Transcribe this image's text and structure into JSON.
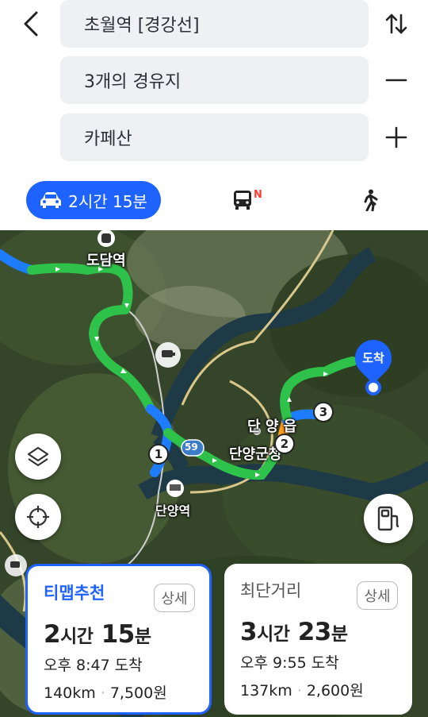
{
  "search": {
    "origin": "초월역 [경강선]",
    "waypoints": "3개의 경유지",
    "destination": "카페산"
  },
  "modes": {
    "car_time": "2시간 15분",
    "bus_badge": "N"
  },
  "map": {
    "labels": {
      "dodam": "도담역",
      "danyang_eup": "단 양 읍",
      "danyang_gun": "단양군청",
      "danyang_station": "단양역",
      "road_no": "59",
      "dest": "도착"
    },
    "waypoint_numbers": [
      "1",
      "2",
      "3"
    ],
    "route_color": "#2fc24a",
    "route_blue": "#1e7cff"
  },
  "routes": [
    {
      "name": "티맵추천",
      "detail": "상세",
      "hours": "2",
      "hours_unit": "시간",
      "minutes": "15",
      "minutes_unit": "분",
      "arrival": "오후 8:47 도착",
      "distance": "140km",
      "fee": "7,500원"
    },
    {
      "name": "최단거리",
      "detail": "상세",
      "hours": "3",
      "hours_unit": "시간",
      "minutes": "23",
      "minutes_unit": "분",
      "arrival": "오후 9:55 도착",
      "distance": "137km",
      "fee": "2,600원"
    }
  ]
}
